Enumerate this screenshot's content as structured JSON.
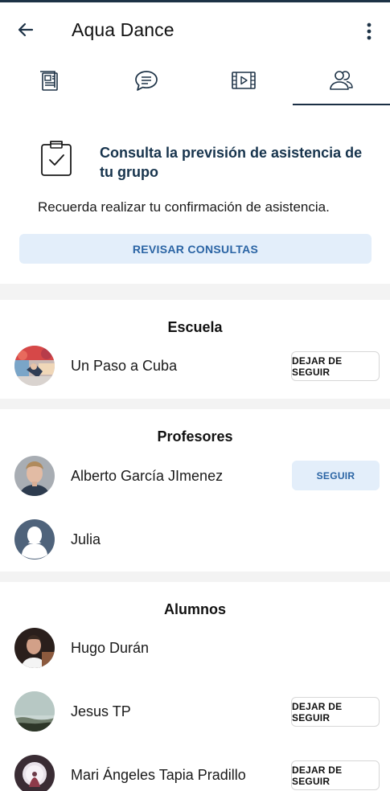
{
  "header": {
    "title": "Aqua Dance",
    "back_icon": "arrow-left-icon",
    "menu_icon": "more-vertical-icon"
  },
  "tabs": [
    {
      "icon": "newspaper-icon",
      "active": false
    },
    {
      "icon": "chat-bubble-icon",
      "active": false
    },
    {
      "icon": "film-icon",
      "active": false
    },
    {
      "icon": "group-users-icon",
      "active": true
    }
  ],
  "consult": {
    "title": "Consulta la previsión de asistencia de tu grupo",
    "text": "Recuerda realizar tu confirmación de asistencia.",
    "button_label": "REVISAR CONSULTAS"
  },
  "sections": {
    "school": {
      "title": "Escuela",
      "rows": [
        {
          "name": "Un Paso a Cuba",
          "button": "DEJAR DE SEGUIR"
        }
      ]
    },
    "teachers": {
      "title": "Profesores",
      "rows": [
        {
          "name": "Alberto García JImenez",
          "button": "SEGUIR"
        },
        {
          "name": "Julia",
          "button": ""
        }
      ]
    },
    "students": {
      "title": "Alumnos",
      "rows": [
        {
          "name": "Hugo Durán",
          "button": ""
        },
        {
          "name": "Jesus TP",
          "button": "DEJAR DE SEGUIR"
        },
        {
          "name": "Mari Ángeles Tapia Pradillo",
          "button": "DEJAR DE SEGUIR"
        }
      ]
    }
  },
  "colors": {
    "accent": "#2a64a4",
    "accent_bg": "#e3eefa",
    "title_dark": "#17344d",
    "divider": "#f3f3f3"
  }
}
